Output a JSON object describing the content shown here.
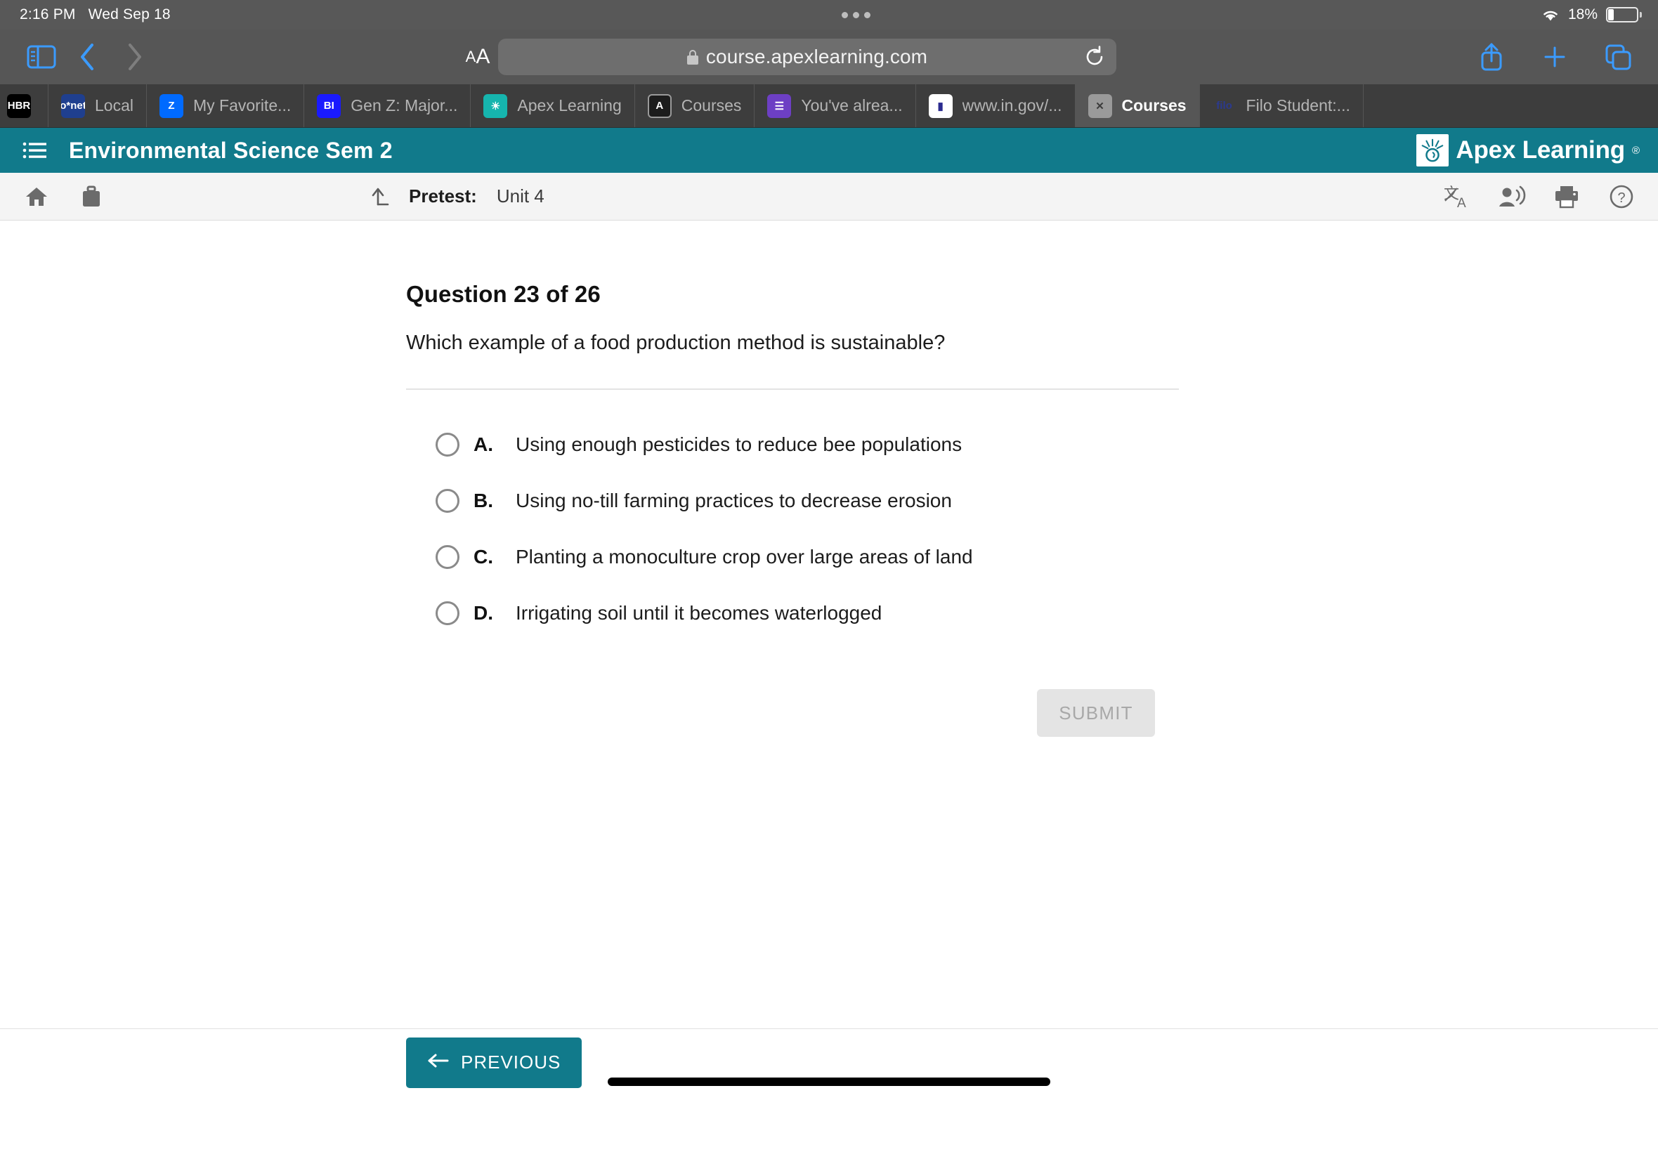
{
  "status_bar": {
    "time": "2:16 PM",
    "date": "Wed Sep 18",
    "battery_percent": "18%",
    "battery_level": 18,
    "wifi_icon": "wifi-icon",
    "battery_icon": "battery-icon"
  },
  "browser": {
    "sidebar_icon": "sidebar-icon",
    "back_icon": "chevron-left-icon",
    "forward_icon": "chevron-right-icon",
    "aa_small": "A",
    "aa_big": "A",
    "lock_icon": "lock-icon",
    "url": "course.apexlearning.com",
    "reload_icon": "reload-icon",
    "share_icon": "share-icon",
    "new_tab_icon": "plus-icon",
    "tabs_overview_icon": "tabs-overview-icon",
    "tabs": [
      {
        "label": "",
        "favicon": "hbr-icon",
        "favicon_text": "HBR",
        "favicon_class": "fav-hbr",
        "active": false
      },
      {
        "label": "Local",
        "favicon": "onet-icon",
        "favicon_text": "o*net",
        "favicon_class": "fav-onet",
        "active": false
      },
      {
        "label": "My Favorite...",
        "favicon": "zillow-icon",
        "favicon_text": "Z",
        "favicon_class": "fav-zillow",
        "active": false
      },
      {
        "label": "Gen Z: Major...",
        "favicon": "business-insider-icon",
        "favicon_text": "BI",
        "favicon_class": "fav-bi",
        "active": false
      },
      {
        "label": "Apex Learning",
        "favicon": "apex-learning-icon",
        "favicon_text": "☀",
        "favicon_class": "fav-apex",
        "active": false
      },
      {
        "label": "Courses",
        "favicon": "apex-courses-icon",
        "favicon_text": "A",
        "favicon_class": "fav-courses",
        "active": false
      },
      {
        "label": "You've alrea...",
        "favicon": "google-forms-icon",
        "favicon_text": "☰",
        "favicon_class": "fav-list",
        "active": false
      },
      {
        "label": "www.in.gov/...",
        "favicon": "in-gov-icon",
        "favicon_text": "▮",
        "favicon_class": "fav-ingov",
        "active": false
      },
      {
        "label": "Courses",
        "favicon": "close-icon",
        "favicon_text": "✕",
        "favicon_class": "fav-x",
        "active": true
      },
      {
        "label": "Filo Student:...",
        "favicon": "filo-icon",
        "favicon_text": "filo",
        "favicon_class": "fav-filo",
        "active": false
      }
    ]
  },
  "apex_header": {
    "menu_icon": "hamburger-menu-icon",
    "course_title": "Environmental Science Sem 2",
    "logo_text": "Apex Learning",
    "logo_registered": "®",
    "logo_icon": "apex-sunburst-logo-icon",
    "background_color": "#117a8b"
  },
  "sub_toolbar": {
    "home_icon": "home-icon",
    "briefcase_icon": "briefcase-icon",
    "up_arrow_icon": "up-level-arrow-icon",
    "activity_label": "Pretest:",
    "activity_value": "Unit 4",
    "translate_icon": "translate-icon",
    "read_aloud_icon": "read-aloud-icon",
    "print_icon": "print-icon",
    "help_icon": "help-icon"
  },
  "question": {
    "heading": "Question 23 of 26",
    "number": 23,
    "total": 26,
    "prompt": "Which example of a food production method is sustainable?",
    "options": [
      {
        "letter": "A.",
        "text": "Using enough pesticides to reduce bee populations",
        "selected": false
      },
      {
        "letter": "B.",
        "text": "Using no-till farming practices to decrease erosion",
        "selected": false
      },
      {
        "letter": "C.",
        "text": "Planting a monoculture crop over large areas of land",
        "selected": false
      },
      {
        "letter": "D.",
        "text": "Irrigating soil until it becomes waterlogged",
        "selected": false
      }
    ],
    "submit_label": "SUBMIT",
    "submit_enabled": false
  },
  "footer": {
    "previous_label": "PREVIOUS",
    "previous_arrow_icon": "arrow-left-icon",
    "home_indicator": "home-indicator"
  }
}
